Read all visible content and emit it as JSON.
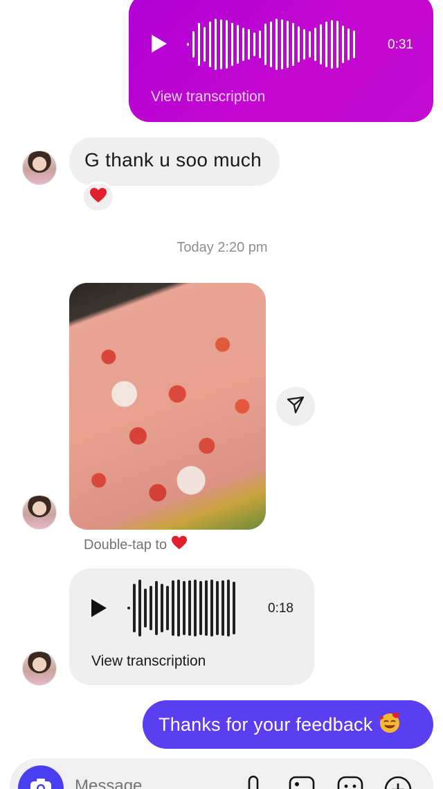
{
  "messages": {
    "voice_out": {
      "duration": "0:31",
      "transcription_label": "View transcription"
    },
    "text_in": "G thank u soo much",
    "reaction_icon": "heart-icon",
    "timestamp": "Today 2:20 pm",
    "photo_hint": "Double-tap to",
    "voice_in": {
      "duration": "0:18",
      "transcription_label": "View transcription"
    },
    "text_out": "Thanks for your feedback"
  },
  "composer": {
    "placeholder": "Message"
  },
  "colors": {
    "voice_out_bg": "#c408cf",
    "text_out_bg": "#5a3ff0",
    "incoming_bg": "#efefef",
    "camera_button": "#4a3ff0",
    "heart": "#e0202e"
  }
}
